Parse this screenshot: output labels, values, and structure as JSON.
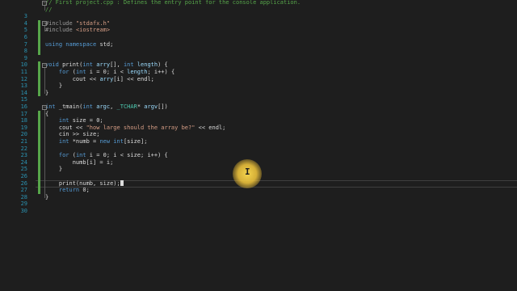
{
  "editor": {
    "highlight_color": "#ffd84f",
    "lines": [
      {
        "n": "",
        "tokens": [
          {
            "c": "cm",
            "t": "// First project.cpp : Defines the entry point for the console application."
          }
        ]
      },
      {
        "n": "",
        "tokens": [
          {
            "c": "cm",
            "t": "//"
          }
        ]
      },
      {
        "n": "3",
        "tokens": []
      },
      {
        "n": "4",
        "tokens": [
          {
            "c": "pp",
            "t": "#include "
          },
          {
            "c": "str",
            "t": "\"stdafx.h\""
          }
        ]
      },
      {
        "n": "5",
        "tokens": [
          {
            "c": "pp",
            "t": "#include "
          },
          {
            "c": "str",
            "t": "<iostream>"
          }
        ]
      },
      {
        "n": "6",
        "tokens": []
      },
      {
        "n": "7",
        "tokens": [
          {
            "c": "kw",
            "t": "using namespace "
          },
          {
            "c": "id",
            "t": "std;"
          }
        ]
      },
      {
        "n": "8",
        "tokens": []
      },
      {
        "n": "9",
        "tokens": []
      },
      {
        "n": "10",
        "tokens": [
          {
            "c": "kw",
            "t": "void "
          },
          {
            "c": "id",
            "t": "print("
          },
          {
            "c": "kw",
            "t": "int "
          },
          {
            "c": "pa",
            "t": "arry"
          },
          {
            "c": "id",
            "t": "[], "
          },
          {
            "c": "kw",
            "t": "int "
          },
          {
            "c": "pa",
            "t": "length"
          },
          {
            "c": "id",
            "t": ") {"
          }
        ]
      },
      {
        "n": "11",
        "tokens": [
          {
            "c": "id",
            "t": "    "
          },
          {
            "c": "kw",
            "t": "for "
          },
          {
            "c": "id",
            "t": "("
          },
          {
            "c": "kw",
            "t": "int "
          },
          {
            "c": "id",
            "t": "i = 0; i < "
          },
          {
            "c": "pa",
            "t": "length"
          },
          {
            "c": "id",
            "t": "; i++) {"
          }
        ]
      },
      {
        "n": "12",
        "tokens": [
          {
            "c": "id",
            "t": "        cout << "
          },
          {
            "c": "pa",
            "t": "arry"
          },
          {
            "c": "id",
            "t": "[i] << endl;"
          }
        ]
      },
      {
        "n": "13",
        "tokens": [
          {
            "c": "id",
            "t": "    }"
          }
        ]
      },
      {
        "n": "14",
        "tokens": [
          {
            "c": "id",
            "t": "}"
          }
        ]
      },
      {
        "n": "15",
        "tokens": []
      },
      {
        "n": "16",
        "tokens": [
          {
            "c": "kw",
            "t": "int "
          },
          {
            "c": "id",
            "t": "_tmain("
          },
          {
            "c": "kw",
            "t": "int "
          },
          {
            "c": "pa",
            "t": "argc"
          },
          {
            "c": "id",
            "t": ", "
          },
          {
            "c": "ty",
            "t": "_TCHAR"
          },
          {
            "c": "id",
            "t": "* "
          },
          {
            "c": "pa",
            "t": "argv"
          },
          {
            "c": "id",
            "t": "[])"
          }
        ]
      },
      {
        "n": "17",
        "tokens": [
          {
            "c": "id",
            "t": "{"
          }
        ]
      },
      {
        "n": "18",
        "tokens": [
          {
            "c": "id",
            "t": "    "
          },
          {
            "c": "kw",
            "t": "int "
          },
          {
            "c": "id",
            "t": "size = 0;"
          }
        ]
      },
      {
        "n": "19",
        "tokens": [
          {
            "c": "id",
            "t": "    cout << "
          },
          {
            "c": "str",
            "t": "\"how large should the array be?\""
          },
          {
            "c": "id",
            "t": " << endl;"
          }
        ]
      },
      {
        "n": "20",
        "tokens": [
          {
            "c": "id",
            "t": "    cin >> size;"
          }
        ]
      },
      {
        "n": "21",
        "tokens": [
          {
            "c": "id",
            "t": "    "
          },
          {
            "c": "kw",
            "t": "int "
          },
          {
            "c": "id",
            "t": "*numb = "
          },
          {
            "c": "kw",
            "t": "new int"
          },
          {
            "c": "id",
            "t": "[size];"
          }
        ]
      },
      {
        "n": "22",
        "tokens": []
      },
      {
        "n": "23",
        "tokens": [
          {
            "c": "id",
            "t": "    "
          },
          {
            "c": "kw",
            "t": "for "
          },
          {
            "c": "id",
            "t": "("
          },
          {
            "c": "kw",
            "t": "int "
          },
          {
            "c": "id",
            "t": "i = 0; i < size; i++) {"
          }
        ]
      },
      {
        "n": "24",
        "tokens": [
          {
            "c": "id",
            "t": "        numb[i] = i;"
          }
        ]
      },
      {
        "n": "25",
        "tokens": [
          {
            "c": "id",
            "t": "    }"
          }
        ]
      },
      {
        "n": "26",
        "tokens": []
      },
      {
        "n": "26",
        "tokens": [
          {
            "c": "id",
            "t": "    print(numb, size);"
          }
        ],
        "caret": true,
        "current": true
      },
      {
        "n": "27",
        "tokens": [
          {
            "c": "id",
            "t": "    "
          },
          {
            "c": "kw",
            "t": "return "
          },
          {
            "c": "id",
            "t": "0;"
          }
        ]
      },
      {
        "n": "28",
        "tokens": [
          {
            "c": "id",
            "t": "}"
          }
        ]
      },
      {
        "n": "29",
        "tokens": []
      },
      {
        "n": "30",
        "tokens": []
      }
    ]
  }
}
